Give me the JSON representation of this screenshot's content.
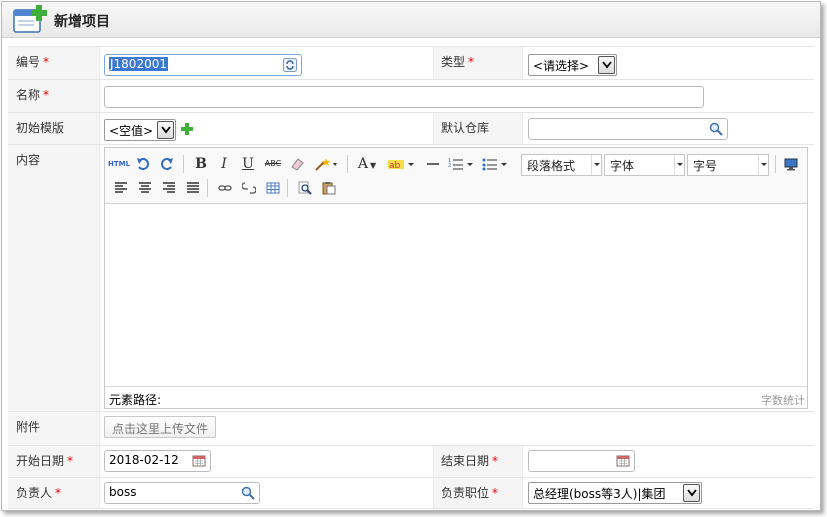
{
  "title": "新增项目",
  "required_mark": "*",
  "fields": {
    "code": {
      "label": "编号",
      "value": "J1802001"
    },
    "type": {
      "label": "类型",
      "value": "<请选择>"
    },
    "name": {
      "label": "名称",
      "value": ""
    },
    "template": {
      "label": "初始模版",
      "value": "<空值>"
    },
    "warehouse": {
      "label": "默认仓库",
      "value": ""
    },
    "content": {
      "label": "内容"
    },
    "attachment": {
      "label": "附件",
      "button": "点击这里上传文件"
    },
    "start_date": {
      "label": "开始日期",
      "value": "2018-02-12"
    },
    "end_date": {
      "label": "结束日期",
      "value": ""
    },
    "owner": {
      "label": "负责人",
      "value": "boss"
    },
    "position": {
      "label": "负责职位",
      "value": "总经理(boss等3人)|集团"
    }
  },
  "editor": {
    "html_label": "HTML",
    "bold": "B",
    "italic": "I",
    "underline": "U",
    "strike": "ABC",
    "font_color": "A",
    "paragraph_format": "段落格式",
    "font_family": "字体",
    "font_size": "字号",
    "path_label": "元素路径:",
    "word_count": "字数统计"
  },
  "colors": {
    "required": "#ee0000",
    "label_bg": "#f5f5f5",
    "selection": "#3a78d4"
  }
}
